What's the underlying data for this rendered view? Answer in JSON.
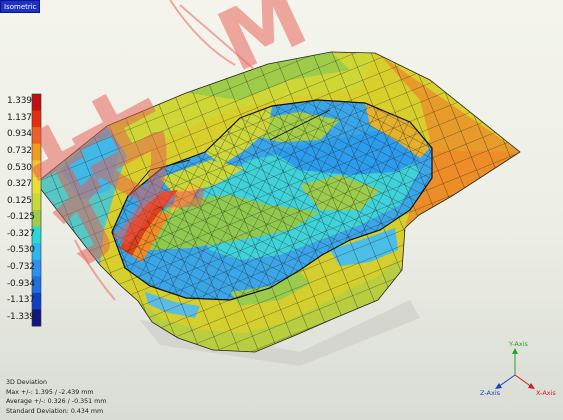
{
  "view": {
    "tab_label": "Isometric"
  },
  "legend": {
    "labels": [
      "1.339",
      "1.137",
      "0.934",
      "0.732",
      "0.530",
      "0.327",
      "0.125",
      "-0.125",
      "-0.327",
      "-0.530",
      "-0.732",
      "-0.934",
      "-1.137",
      "-1.339"
    ],
    "colors": [
      "#c01010",
      "#e03010",
      "#f06020",
      "#f49a20",
      "#f4c23a",
      "#e8de36",
      "#c8d83a",
      "#9ecb4a",
      "#2fd6d6",
      "#2cb8ee",
      "#3090ee",
      "#2070e0",
      "#1040c0",
      "#101880"
    ]
  },
  "stats": {
    "title": "3D Deviation",
    "max": "Max +/-: 1.395 / -2.439 mm",
    "average": "Average +/-: 0.326 / -0.351 mm",
    "std": "Standard Deviation: 0.434 mm"
  },
  "axes": {
    "y_label": "Y-Axis",
    "z_label": "Z-Axis",
    "x_label": "X-Axis",
    "y_color": "#2aa02a",
    "z_color": "#2040c0",
    "x_color": "#d02020"
  },
  "watermark": {
    "text1": "技",
    "text2": "M"
  }
}
